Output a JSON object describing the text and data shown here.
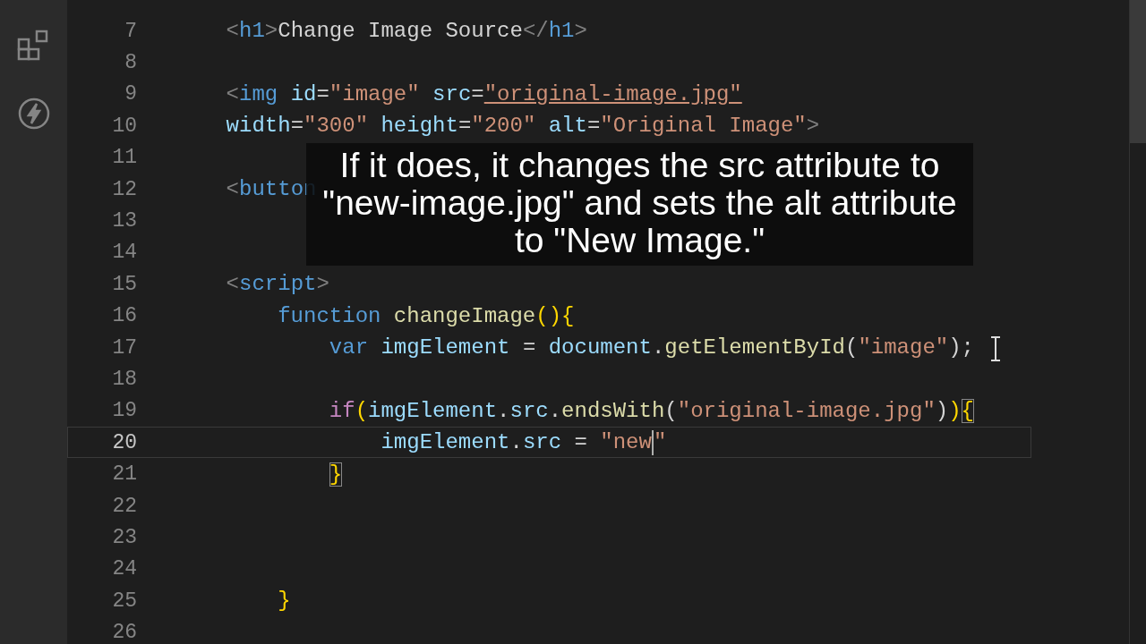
{
  "editor": {
    "lines": [
      {
        "number": "7",
        "current": false,
        "tokens": [
          {
            "kind": "punct",
            "text": "    <"
          },
          {
            "kind": "tag",
            "text": "h1"
          },
          {
            "kind": "punct",
            "text": ">"
          },
          {
            "kind": "text",
            "text": "Change Image Source"
          },
          {
            "kind": "punct",
            "text": "</"
          },
          {
            "kind": "tag",
            "text": "h1"
          },
          {
            "kind": "punct",
            "text": ">"
          }
        ]
      },
      {
        "number": "8",
        "current": false
      },
      {
        "number": "9",
        "current": false,
        "tokens": [
          {
            "kind": "punct",
            "text": "    <"
          },
          {
            "kind": "tag",
            "text": "img"
          },
          {
            "kind": "attr",
            "text": " id"
          },
          {
            "kind": "text",
            "text": "="
          },
          {
            "kind": "string",
            "text": "\"image\""
          },
          {
            "kind": "attr",
            "text": " src"
          },
          {
            "kind": "text",
            "text": "="
          },
          {
            "kind": "string",
            "text": "\"original-image.jpg\"",
            "link": true
          }
        ]
      },
      {
        "number": "10",
        "current": false,
        "tokens": [
          {
            "kind": "attr",
            "text": "    width"
          },
          {
            "kind": "text",
            "text": "="
          },
          {
            "kind": "string",
            "text": "\"300\""
          },
          {
            "kind": "attr",
            "text": " height"
          },
          {
            "kind": "text",
            "text": "="
          },
          {
            "kind": "string",
            "text": "\"200\""
          },
          {
            "kind": "attr",
            "text": " alt"
          },
          {
            "kind": "text",
            "text": "="
          },
          {
            "kind": "string",
            "text": "\"Original Image\""
          },
          {
            "kind": "punct",
            "text": ">"
          }
        ]
      },
      {
        "number": "11",
        "current": false
      },
      {
        "number": "12",
        "current": false,
        "tokens": [
          {
            "kind": "punct",
            "text": "    <"
          },
          {
            "kind": "tag",
            "text": "button"
          }
        ]
      },
      {
        "number": "13",
        "current": false
      },
      {
        "number": "14",
        "current": false
      },
      {
        "number": "15",
        "current": false,
        "tokens": [
          {
            "kind": "punct",
            "text": "    <"
          },
          {
            "kind": "tag",
            "text": "script"
          },
          {
            "kind": "punct",
            "text": ">"
          }
        ]
      },
      {
        "number": "16",
        "current": false,
        "tokens": [
          {
            "kind": "keyword",
            "text": "        function "
          },
          {
            "kind": "function",
            "text": "changeImage"
          },
          {
            "kind": "brace",
            "text": "(){"
          }
        ]
      },
      {
        "number": "17",
        "current": false,
        "tokens": [
          {
            "kind": "keyword",
            "text": "            var"
          },
          {
            "kind": "variable",
            "text": " imgElement"
          },
          {
            "kind": "text",
            "text": " = "
          },
          {
            "kind": "variable",
            "text": "document"
          },
          {
            "kind": "text",
            "text": "."
          },
          {
            "kind": "function",
            "text": "getElementById"
          },
          {
            "kind": "text",
            "text": "("
          },
          {
            "kind": "string",
            "text": "\"image\""
          },
          {
            "kind": "text",
            "text": ");"
          }
        ]
      },
      {
        "number": "18",
        "current": false
      },
      {
        "number": "19",
        "current": false,
        "tokens": [
          {
            "kind": "control",
            "text": "            if"
          },
          {
            "kind": "brace",
            "text": "("
          },
          {
            "kind": "variable",
            "text": "imgElement"
          },
          {
            "kind": "text",
            "text": "."
          },
          {
            "kind": "variable",
            "text": "src"
          },
          {
            "kind": "text",
            "text": "."
          },
          {
            "kind": "function",
            "text": "endsWith"
          },
          {
            "kind": "text",
            "text": "("
          },
          {
            "kind": "string",
            "text": "\"original-image.jpg\""
          },
          {
            "kind": "text",
            "text": ")"
          },
          {
            "kind": "brace",
            "text": ")"
          },
          {
            "kind": "match",
            "text": "{"
          }
        ]
      },
      {
        "number": "20",
        "current": true,
        "tokens": [
          {
            "kind": "variable",
            "text": "                imgElement"
          },
          {
            "kind": "text",
            "text": "."
          },
          {
            "kind": "variable",
            "text": "src"
          },
          {
            "kind": "text",
            "text": " = "
          },
          {
            "kind": "string",
            "text": "\"new",
            "caret_after": true
          },
          {
            "kind": "string",
            "text": "\""
          }
        ]
      },
      {
        "number": "21",
        "current": false,
        "tokens": [
          {
            "kind": "match",
            "text": "            }"
          }
        ]
      },
      {
        "number": "22",
        "current": false
      },
      {
        "number": "23",
        "current": false
      },
      {
        "number": "24",
        "current": false
      },
      {
        "number": "25",
        "current": false,
        "tokens": [
          {
            "kind": "brace",
            "text": "        }"
          }
        ]
      },
      {
        "number": "26",
        "current": false
      }
    ]
  },
  "caption": "If it does, it changes the src attribute to \"new-image.jpg\" and sets the alt attribute to \"New Image.\""
}
